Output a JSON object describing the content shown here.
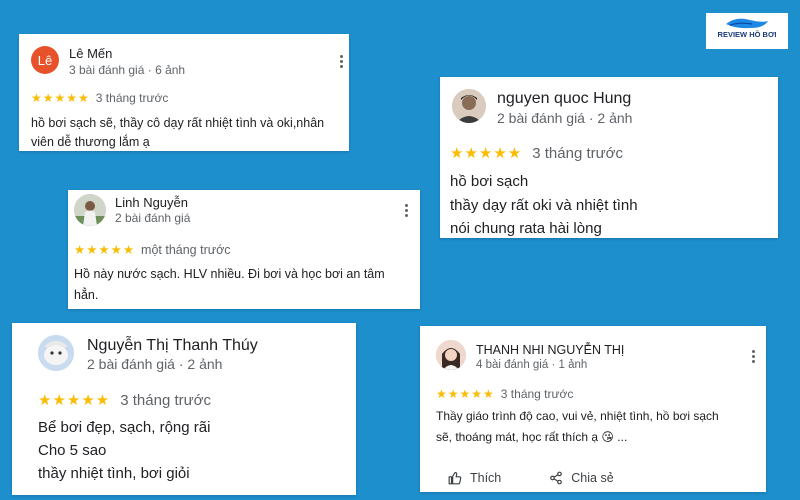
{
  "logo": {
    "text": "REVIEW HỒ BƠI"
  },
  "reviews": [
    {
      "avatar_initial": "Lê",
      "name": "Lê Mến",
      "meta": "3 bài đánh giá · 6 ảnh",
      "stars": "★★★★★",
      "rating": 5,
      "time": "3 tháng trước",
      "lines": [
        "hồ bơi sạch sẽ, thầy cô dạy rất nhiệt tình và oki,nhân",
        "viên dễ thương lắm ạ"
      ]
    },
    {
      "name": "nguyen quoc Hung",
      "meta": "2 bài đánh giá · 2 ảnh",
      "stars": "★★★★★",
      "rating": 5,
      "time": "3 tháng trước",
      "lines": [
        "hồ bơi sạch",
        "thầy dạy rất oki và nhiệt tình",
        "nói chung rata hài lòng"
      ]
    },
    {
      "name": "Linh Nguyễn",
      "meta": "2 bài đánh giá",
      "stars": "★★★★★",
      "rating": 5,
      "time": "một tháng trước",
      "lines": [
        "Hồ này nước sạch. HLV nhiều. Đi bơi và học bơi an tâm",
        "hẳn."
      ]
    },
    {
      "name": "Nguyễn Thị Thanh Thúy",
      "meta": "2 bài đánh giá · 2 ảnh",
      "stars": "★★★★★",
      "rating": 5,
      "time": "3 tháng trước",
      "lines": [
        "Bể bơi đẹp, sạch, rộng rãi",
        "Cho 5 sao",
        "thầy nhiệt tình, bơi giỏi"
      ]
    },
    {
      "name": "THANH NHI NGUYỄN THỊ",
      "meta": "4 bài đánh giá · 1 ảnh",
      "stars": "★★★★★",
      "rating": 5,
      "time": "3 tháng trước",
      "lines": [
        "Thầy giáo trình độ cao, vui vẻ, nhiệt tình, hồ bơi sạch",
        "sẽ, thoáng mát, học rất thích ạ 😘 ..."
      ],
      "like_label": "Thích",
      "share_label": "Chia sẻ"
    }
  ],
  "colors": {
    "background": "#1d8fcd",
    "star": "#fbbc04",
    "avatar_le": "#e8522b"
  }
}
